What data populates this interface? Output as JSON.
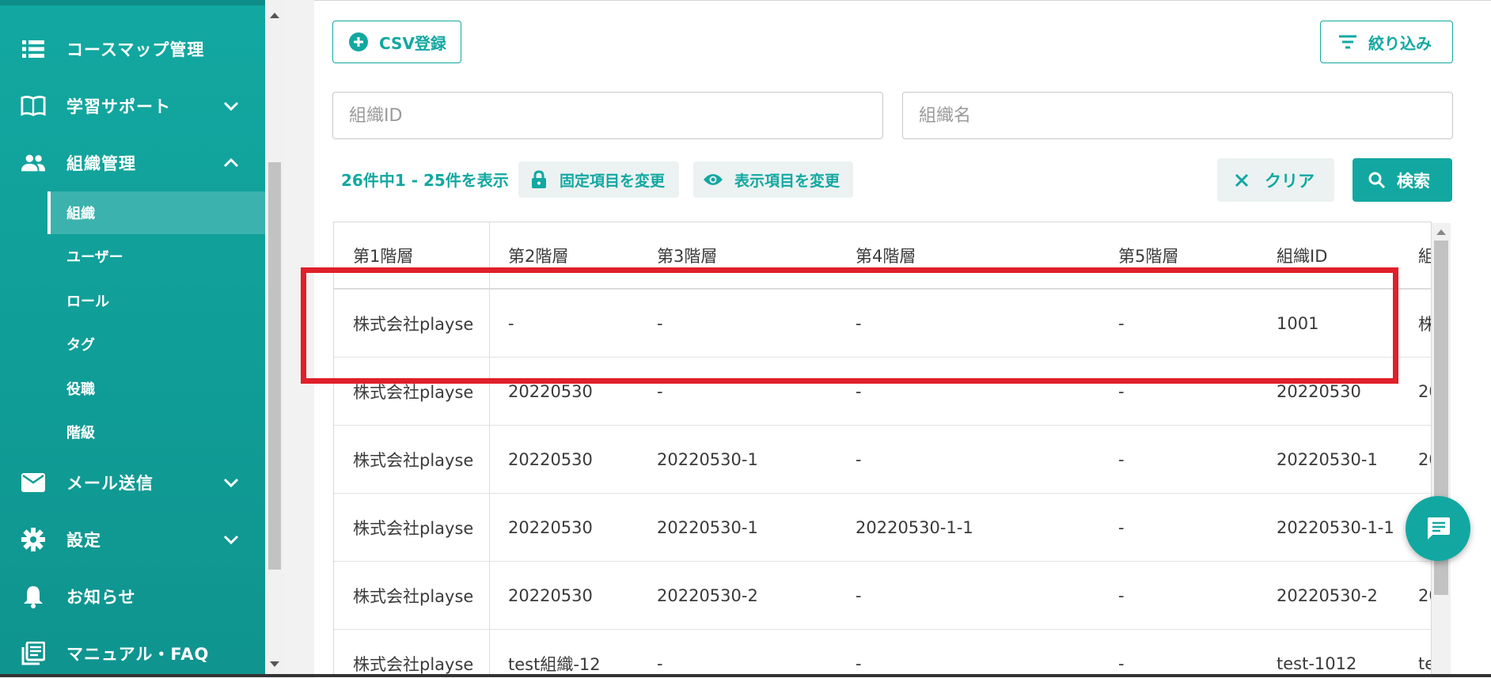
{
  "sidebar": {
    "items": [
      {
        "label": "コースマップ管理",
        "icon": "list-icon"
      },
      {
        "label": "学習サポート",
        "icon": "book-icon"
      },
      {
        "label": "組織管理",
        "icon": "people-icon"
      },
      {
        "label": "メール送信",
        "icon": "mail-icon"
      },
      {
        "label": "設定",
        "icon": "gear-icon"
      },
      {
        "label": "お知らせ",
        "icon": "bell-icon"
      },
      {
        "label": "マニュアル・FAQ",
        "icon": "manual-icon"
      }
    ],
    "subitems": [
      {
        "label": "組織",
        "active": true
      },
      {
        "label": "ユーザー"
      },
      {
        "label": "ロール"
      },
      {
        "label": "タグ"
      },
      {
        "label": "役職"
      },
      {
        "label": "階級"
      }
    ]
  },
  "toolbar": {
    "csv_label": "CSV登録",
    "filter_label": "絞り込み"
  },
  "search": {
    "org_id_placeholder": "組織ID",
    "org_name_placeholder": "組織名",
    "result_count": "26件中1 - 25件を表示",
    "fixed_label": "固定項目を変更",
    "display_label": "表示項目を変更",
    "clear_label": "クリア",
    "search_label": "検索"
  },
  "table": {
    "headers": [
      "第1階層",
      "第2階層",
      "第3階層",
      "第4階層",
      "第5階層",
      "組織ID",
      "組"
    ],
    "rows": [
      [
        "株式会社playse",
        "-",
        "-",
        "-",
        "-",
        "1001",
        "株"
      ],
      [
        "株式会社playse",
        "20220530",
        "-",
        "-",
        "-",
        "20220530",
        "20"
      ],
      [
        "株式会社playse",
        "20220530",
        "20220530-1",
        "-",
        "-",
        "20220530-1",
        "20"
      ],
      [
        "株式会社playse",
        "20220530",
        "20220530-1",
        "20220530-1-1",
        "-",
        "20220530-1-1",
        "20"
      ],
      [
        "株式会社playse",
        "20220530",
        "20220530-2",
        "-",
        "-",
        "20220530-2",
        "20"
      ],
      [
        "株式会社playse",
        "test組織-12",
        "-",
        "-",
        "-",
        "test-1012",
        "te"
      ]
    ]
  },
  "colors": {
    "accent": "#12a8a1",
    "highlight": "#e0202a"
  }
}
